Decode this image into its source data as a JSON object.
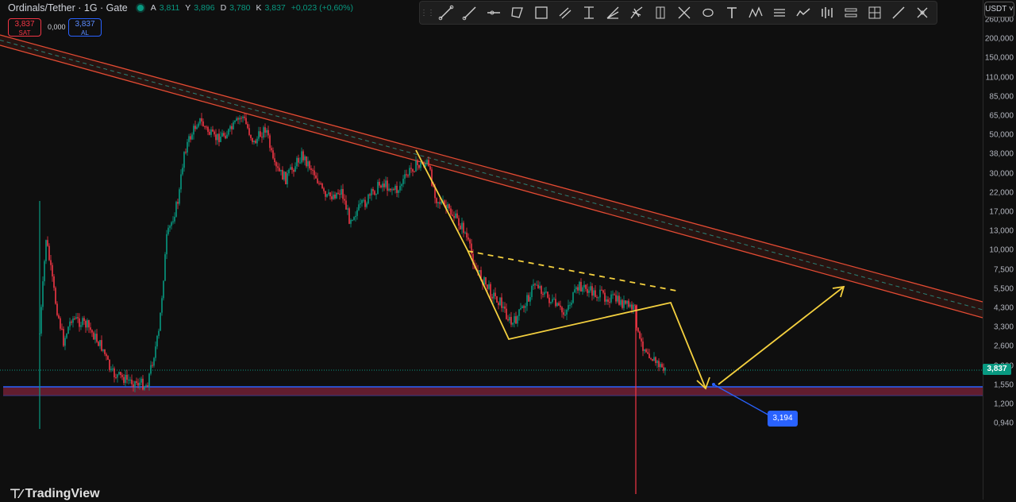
{
  "legend": {
    "symbol": "Ordinals/Tether · 1G · Gate",
    "open_label": "A",
    "open": "3,811",
    "high_label": "Y",
    "high": "3,896",
    "low_label": "D",
    "low": "3,780",
    "close_label": "K",
    "close": "3,837",
    "change": "+0,023 (+0,60%)"
  },
  "trade": {
    "sell_price": "3,837",
    "sell_label": "SAT",
    "spread": "0,000",
    "buy_price": "3,837",
    "buy_label": "AL"
  },
  "currency": "USDT ˅",
  "last_price": "3,837",
  "price_axis": [
    "260,000",
    "200,000",
    "150,000",
    "110,000",
    "85,000",
    "65,000",
    "50,000",
    "38,000",
    "30,000",
    "22,000",
    "17,000",
    "13,000",
    "10,000",
    "7,500",
    "5,500",
    "4,300",
    "3,300",
    "2,600",
    "2,000",
    "1,550",
    "1,200",
    "0,940"
  ],
  "annotation_label": "3,194",
  "brand": "TradingView",
  "toolbar_icons": [
    "trend-line-icon",
    "ray-icon",
    "horizontal-ray-icon",
    "rotated-rectangle-icon",
    "rectangle-icon",
    "parallel-channel-icon",
    "fib-retracement-icon",
    "fib-fan-icon",
    "pitchfork-icon",
    "long-position-icon",
    "brush-icon",
    "shape-icon",
    "text-icon",
    "pattern-icon",
    "ruler-icon",
    "path-icon",
    "candles-icon",
    "measure-icon",
    "grid-icon",
    "pen-icon",
    "crosshair-icon"
  ],
  "colors": {
    "up": "#089981",
    "down": "#f23645",
    "channel": "#e44b33",
    "pattern": "#f4d03f",
    "support_zone": "#6b1f33",
    "support_line": "#2962ff",
    "arrow_blue": "#2962ff"
  }
}
